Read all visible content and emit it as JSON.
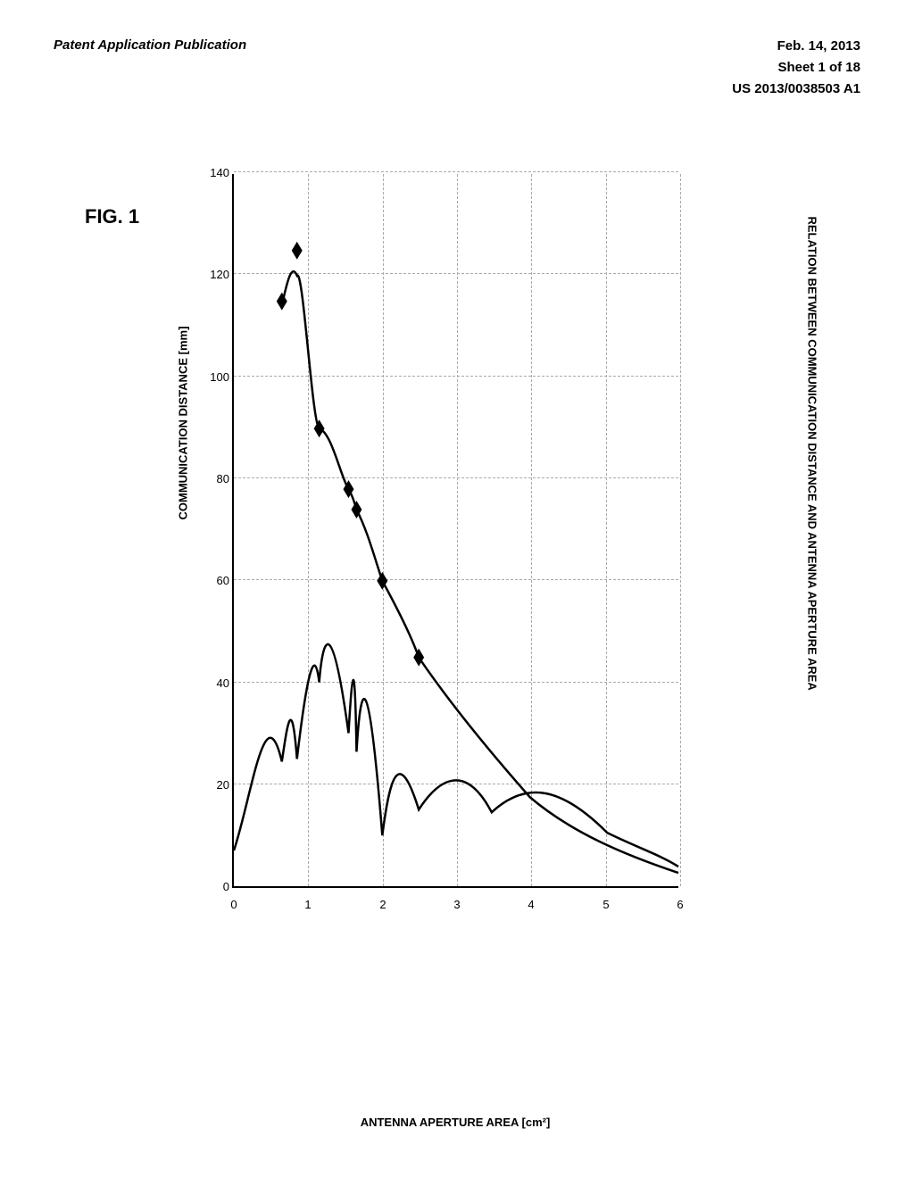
{
  "header": {
    "left_line1": "Patent Application Publication",
    "right_date": "Feb. 14, 2013",
    "right_sheet": "Sheet 1 of 18",
    "right_patent": "US 2013/0038503 A1"
  },
  "figure": {
    "label": "FIG. 1",
    "y_axis_label": "COMMUNICATION DISTANCE [mm]",
    "x_axis_label": "ANTENNA APERTURE AREA [cm²]",
    "subtitle": "RELATION BETWEEN COMMUNICATION DISTANCE AND ANTENNA APERTURE AREA",
    "y_ticks": [
      "0",
      "20",
      "40",
      "60",
      "80",
      "100",
      "120",
      "140"
    ],
    "x_ticks": [
      "0",
      "1",
      "2",
      "3",
      "4",
      "5",
      "6"
    ],
    "data_points": [
      {
        "x": 0.65,
        "y": 115
      },
      {
        "x": 0.85,
        "y": 125
      },
      {
        "x": 1.55,
        "y": 78
      },
      {
        "x": 1.65,
        "y": 74
      },
      {
        "x": 1.15,
        "y": 90
      },
      {
        "x": 2.0,
        "y": 60
      },
      {
        "x": 2.5,
        "y": 45
      }
    ]
  }
}
